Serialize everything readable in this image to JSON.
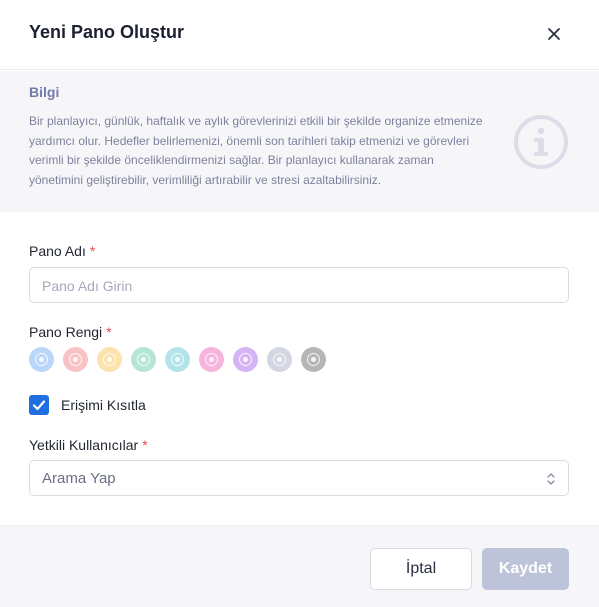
{
  "dialog": {
    "title": "Yeni Pano Oluştur",
    "close_icon": "close-icon"
  },
  "info": {
    "title": "Bilgi",
    "text": "Bir planlayıcı, günlük, haftalık ve aylık görevlerinizi etkili bir şekilde organize etmenize yardımcı olur. Hedefler belirlemenizi, önemli son tarihleri takip etmenizi ve görevleri verimli bir şekilde önceliklendirmenizi sağlar. Bir planlayıcı kullanarak zaman yönetimini geliştirebilir, verimliliği artırabilir ve stresi azaltabilirsiniz.",
    "icon": "info-circle-icon"
  },
  "form": {
    "board_name": {
      "label": "Pano Adı",
      "required": "*",
      "placeholder": "Pano Adı Girin",
      "value": ""
    },
    "board_color": {
      "label": "Pano Rengi",
      "required": "*",
      "colors": [
        "#bcd6fb",
        "#f9c3c6",
        "#fde2ad",
        "#b4e6d3",
        "#b3e4ea",
        "#f7b4dc",
        "#d6b3f5",
        "#d4d6e2",
        "#b6b6b6"
      ]
    },
    "restrict_access": {
      "label": "Erişimi Kısıtla",
      "checked": true
    },
    "authorized_users": {
      "label": "Yetkili Kullanıcılar",
      "required": "*",
      "placeholder": "Arama Yap"
    }
  },
  "footer": {
    "cancel_label": "İptal",
    "save_label": "Kaydet"
  },
  "colors": {
    "primary": "#1f6fe0",
    "save_disabled": "#bdc3d9",
    "required": "#e5484d",
    "info_accent": "#7379a8"
  }
}
